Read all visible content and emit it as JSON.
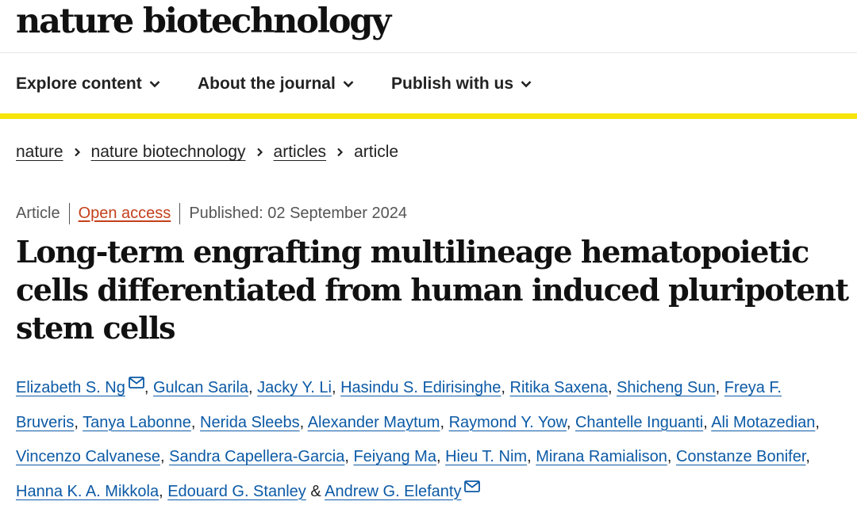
{
  "site": {
    "logo": "nature biotechnology"
  },
  "nav": {
    "items": [
      {
        "label": "Explore content",
        "icon": "chevron-down-icon"
      },
      {
        "label": "About the journal",
        "icon": "chevron-down-icon"
      },
      {
        "label": "Publish with us",
        "icon": "chevron-down-icon"
      }
    ]
  },
  "breadcrumb": {
    "items": [
      "nature",
      "nature biotechnology",
      "articles",
      "article"
    ],
    "separator_icon": "chevron-right-icon"
  },
  "article": {
    "type": "Article",
    "access": "Open access",
    "published": "Published: 02 September 2024",
    "title": "Long-term engrafting multilineage hematopoietic cells differentiated from human induced pluripotent stem cells",
    "authors": [
      "Elizabeth S. Ng",
      "Gulcan Sarila",
      "Jacky Y. Li",
      "Hasindu S. Edirisinghe",
      "Ritika Saxena",
      "Shicheng Sun",
      "Freya F. Bruveris",
      "Tanya Labonne",
      "Nerida Sleebs",
      "Alexander Maytum",
      "Raymond Y. Yow",
      "Chantelle Inguanti",
      "Ali Motazedian",
      "Vincenzo Calvanese",
      "Sandra Capellera-Garcia",
      "Feiyang Ma",
      "Hieu T. Nim",
      "Mirana Ramialison",
      "Constanze Bonifer",
      "Hanna K. A. Mikkola",
      "Edouard G. Stanley",
      "Andrew G. Elefanty"
    ],
    "separator": ", ",
    "last_separator": " & ",
    "corresponding_icon": "mail-icon"
  },
  "colors": {
    "accent_yellow": "#f6e40a",
    "link_blue": "#0c5aa6",
    "open_access_orange": "#c4401c"
  }
}
